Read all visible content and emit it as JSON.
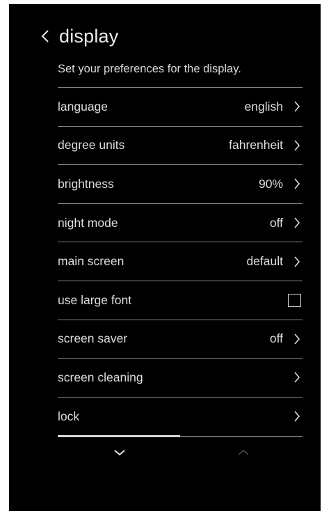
{
  "header": {
    "title": "display",
    "back_icon": "chevron-left-icon"
  },
  "subtitle": "Set your preferences for the display.",
  "settings": [
    {
      "label": "language",
      "value": "english",
      "type": "link"
    },
    {
      "label": "degree units",
      "value": "fahrenheit",
      "type": "link"
    },
    {
      "label": "brightness",
      "value": "90%",
      "type": "link"
    },
    {
      "label": "night mode",
      "value": "off",
      "type": "link"
    },
    {
      "label": "main screen",
      "value": "default",
      "type": "link"
    },
    {
      "label": "use large font",
      "value": "",
      "type": "checkbox",
      "checked": false
    },
    {
      "label": "screen saver",
      "value": "off",
      "type": "link"
    },
    {
      "label": "screen cleaning",
      "value": "",
      "type": "link"
    },
    {
      "label": "lock",
      "value": "",
      "type": "link"
    }
  ],
  "scroll": {
    "position_fraction": 0.5
  },
  "nav": {
    "down_icon": "chevron-down-icon",
    "up_icon": "chevron-up-icon"
  },
  "colors": {
    "background": "#000000",
    "text": "#dedede",
    "divider": "#8a8a8a"
  }
}
